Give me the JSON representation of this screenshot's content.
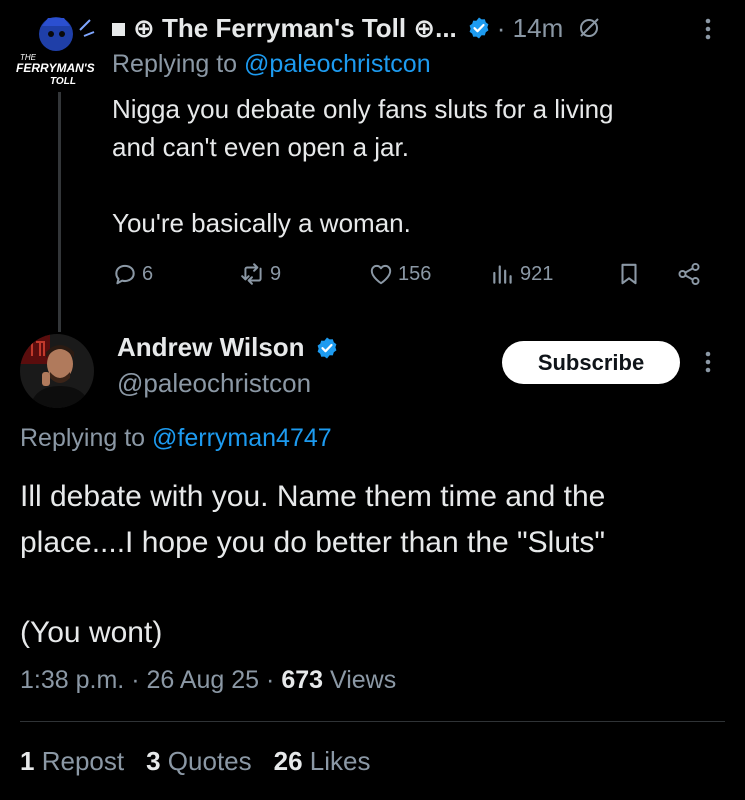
{
  "reply_tweet": {
    "display_name": "⊕ The Ferryman's Toll ⊕...",
    "time_ago": "· 14m",
    "replying_prefix": "Replying to",
    "replying_to": "@paleochristcon",
    "body_lines": [
      "Nigga you debate only fans sluts for a living",
      "and can't even open a jar.",
      "You're basically a woman."
    ],
    "avatar_text": [
      "THE",
      "FERRYMAN'S",
      "TOLL"
    ],
    "actions": {
      "replies": "6",
      "reposts": "9",
      "likes": "156",
      "views": "921"
    }
  },
  "main_tweet": {
    "display_name": "Andrew Wilson",
    "handle": "@paleochristcon",
    "subscribe_label": "Subscribe",
    "replying_prefix": "Replying to",
    "replying_to": "@ferryman4747",
    "body_lines": [
      "Ill debate with you. Name them time and the",
      "place....I hope you do better than the \"Sluts\"",
      "(You wont)"
    ],
    "time": "1:38 p.m.",
    "sep": "·",
    "date": "26 Aug 25",
    "views_count": "673",
    "views_label": "Views",
    "stats": {
      "reposts_count": "1",
      "reposts_label": "Repost",
      "quotes_count": "3",
      "quotes_label": "Quotes",
      "likes_count": "26",
      "likes_label": "Likes"
    }
  },
  "colors": {
    "background": "#000000",
    "text_primary": "#e7e9ea",
    "text_secondary": "#8b98a5",
    "link": "#1d9bf0",
    "verified": "#1d9bf0",
    "button_bg": "#ffffff",
    "divider": "#2f3336"
  },
  "icons": {
    "reply": "comment-icon",
    "repost": "repost-icon",
    "like": "heart-icon",
    "views": "bar-chart-icon",
    "bookmark": "bookmark-icon",
    "share": "share-icon",
    "verified": "verified-badge-icon",
    "muted": "mute-icon",
    "more": "more-vertical-icon"
  }
}
